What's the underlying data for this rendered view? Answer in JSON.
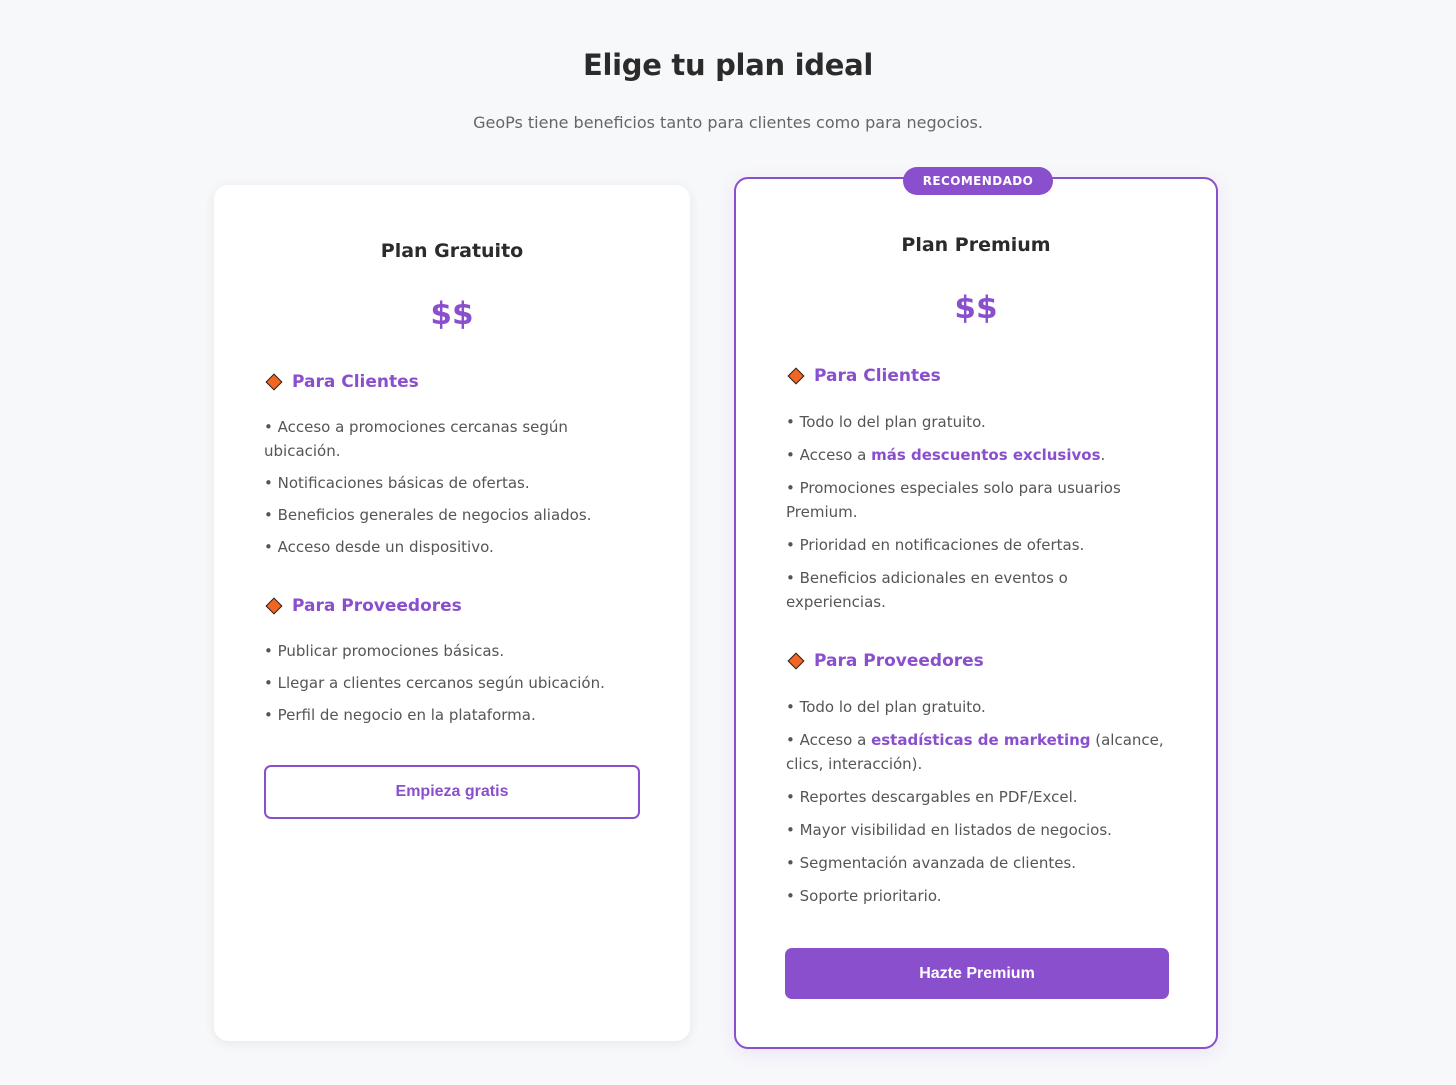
{
  "header": {
    "title": "Elige tu plan ideal",
    "subtitle": "GeoPs tiene beneficios tanto para clientes como para negocios."
  },
  "plans": [
    {
      "name": "Plan Gratuito",
      "price": "$$",
      "clients": {
        "title": "Para Clientes",
        "items": [
          "• Acceso a promociones cercanas según ubicación.",
          "• Notificaciones básicas de ofertas.",
          "• Beneficios generales de negocios aliados.",
          "• Acceso desde un dispositivo."
        ]
      },
      "providers": {
        "title": "Para Proveedores",
        "items": [
          "• Publicar promociones básicas.",
          "• Llegar a clientes cercanos según ubicación.",
          "• Perfil de negocio en la plataforma."
        ]
      },
      "button_label": "Empieza gratis"
    },
    {
      "badge": "RECOMENDADO",
      "name": "Plan Premium",
      "price": "$$",
      "clients": {
        "title": "Para Clientes",
        "item1": "• Todo lo del plan gratuito.",
        "item2_prefix": "• Acceso a ",
        "item2_accent": "más descuentos exclusivos",
        "item2_suffix": ".",
        "item3": "• Promociones especiales solo para usuarios Premium.",
        "item4": "• Prioridad en notificaciones de ofertas.",
        "item5": "• Beneficios adicionales en eventos o experiencias."
      },
      "providers": {
        "title": "Para Proveedores",
        "item1": "• Todo lo del plan gratuito.",
        "item2_prefix": "• Acceso a ",
        "item2_accent": "estadísticas de marketing",
        "item2_suffix": " (alcance, clics, interacción).",
        "item3": "• Reportes descargables en PDF/Excel.",
        "item4": "• Mayor visibilidad en listados de negocios.",
        "item5": "• Segmentación avanzada de clientes.",
        "item6": "• Soporte prioritario."
      },
      "button_label": "Hazte Premium"
    }
  ],
  "colors": {
    "accent": "#8a4fcc",
    "diamond": "#f26522",
    "background": "#f7f8fa"
  },
  "icons": {
    "section_bullet": "diamond-icon"
  }
}
